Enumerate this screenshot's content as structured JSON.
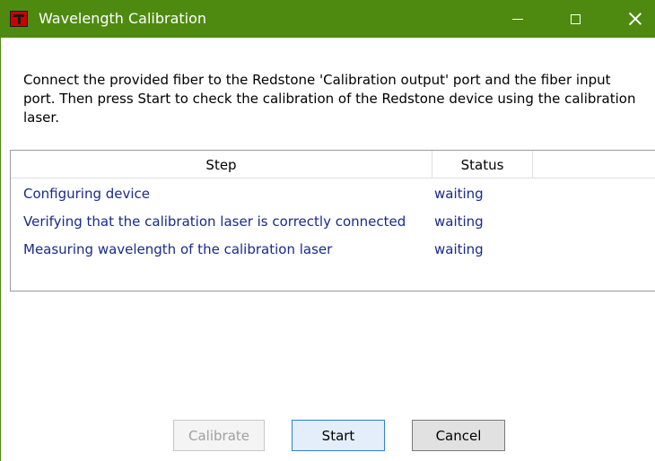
{
  "window": {
    "title": "Wavelength Calibration",
    "accent_color": "#4f8a10",
    "icon": "redstone-app-icon"
  },
  "controls": {
    "minimize_icon": "minimize-icon",
    "maximize_icon": "maximize-icon",
    "close_icon": "close-icon"
  },
  "instructions": "Connect the provided fiber to the Redstone 'Calibration output' port and the fiber input port. Then press Start to check the calibration of the Redstone device using the calibration laser.",
  "table": {
    "headers": [
      "Step",
      "Status"
    ],
    "rows": [
      {
        "step": "Configuring device",
        "status": "waiting"
      },
      {
        "step": "Verifying that the calibration laser is correctly connected",
        "status": "waiting"
      },
      {
        "step": "Measuring wavelength of the calibration laser",
        "status": "waiting"
      }
    ]
  },
  "buttons": {
    "calibrate": "Calibrate",
    "start": "Start",
    "cancel": "Cancel"
  }
}
